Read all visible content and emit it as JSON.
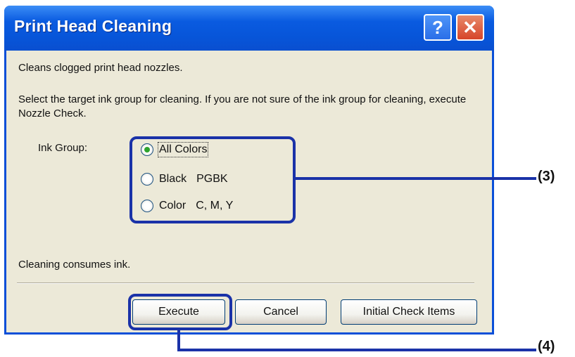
{
  "dialog": {
    "title": "Print Head Cleaning",
    "help_glyph": "?",
    "close_glyph": "✕",
    "description": "Cleans clogged print head nozzles.",
    "instruction": "Select the target ink group for cleaning. If you are not sure of the ink group for cleaning, execute Nozzle Check.",
    "ink_group_label": "Ink Group:",
    "options": [
      {
        "label": "All Colors",
        "sub": "",
        "selected": true
      },
      {
        "label": "Black",
        "sub": "PGBK",
        "selected": false
      },
      {
        "label": "Color",
        "sub": "C, M, Y",
        "selected": false
      }
    ],
    "note": "Cleaning consumes ink.",
    "buttons": {
      "execute": "Execute",
      "cancel": "Cancel",
      "initial_check": "Initial Check Items"
    }
  },
  "callouts": {
    "radios": "(3)",
    "execute": "(4)"
  },
  "colors": {
    "titlebar": "#0a5be0",
    "highlight": "#1a32a8",
    "radio_dot": "#2ea32e",
    "dialog_bg": "#ece9d8"
  }
}
